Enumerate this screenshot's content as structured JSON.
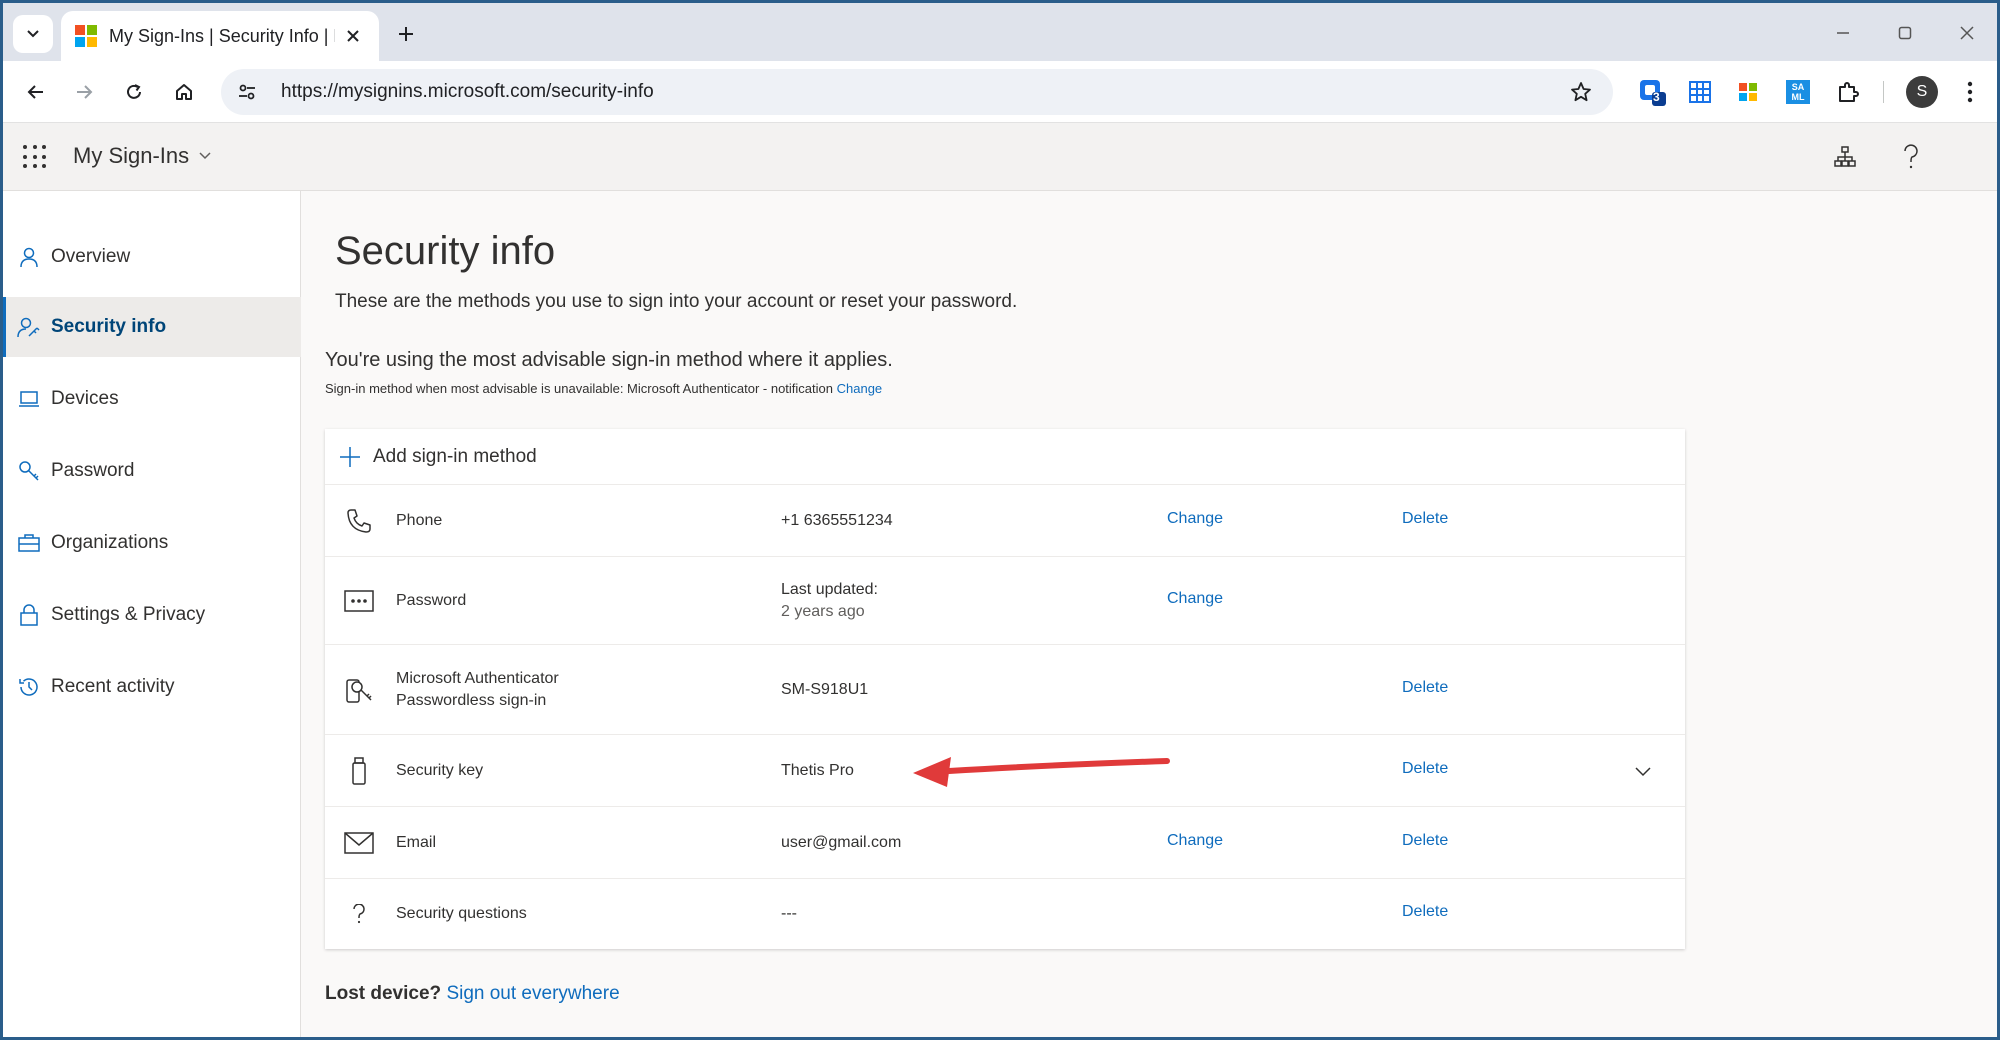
{
  "browser": {
    "tab_title": "My Sign-Ins | Security Info | Mic",
    "url": "https://mysignins.microsoft.com/security-info",
    "ext_badge": "3",
    "ext_saml": "SA ML",
    "profile_initial": "S"
  },
  "app": {
    "name": "My Sign-Ins"
  },
  "sidebar": {
    "items": [
      {
        "label": "Overview",
        "icon": "person-icon"
      },
      {
        "label": "Security info",
        "icon": "person-key-icon",
        "active": true
      },
      {
        "label": "Devices",
        "icon": "laptop-icon"
      },
      {
        "label": "Password",
        "icon": "key-icon"
      },
      {
        "label": "Organizations",
        "icon": "briefcase-icon"
      },
      {
        "label": "Settings & Privacy",
        "icon": "lock-icon"
      },
      {
        "label": "Recent activity",
        "icon": "history-icon"
      }
    ]
  },
  "main": {
    "title": "Security info",
    "subtitle": "These are the methods you use to sign into your account or reset your password.",
    "advisable": "You're using the most advisable sign-in method where it applies.",
    "fallback_text": "Sign-in method when most advisable is unavailable: Microsoft Authenticator - notification",
    "fallback_change": "Change",
    "add_method": "Add sign-in method",
    "methods": [
      {
        "name": "Phone",
        "value": "+1 6365551234",
        "change": "Change",
        "delete": "Delete",
        "icon": "phone-icon"
      },
      {
        "name": "Password",
        "value_line1": "Last updated:",
        "value_line2": "2 years ago",
        "change": "Change",
        "icon": "password-dots-icon"
      },
      {
        "name_line1": "Microsoft Authenticator",
        "name_line2": "Passwordless sign-in",
        "value": "SM-S918U1",
        "delete": "Delete",
        "icon": "authenticator-icon"
      },
      {
        "name": "Security key",
        "value": "Thetis Pro",
        "delete": "Delete",
        "icon": "usb-key-icon"
      },
      {
        "name": "Email",
        "value": "user@gmail.com",
        "change": "Change",
        "delete": "Delete",
        "icon": "mail-icon"
      },
      {
        "name": "Security questions",
        "value": "---",
        "delete": "Delete",
        "icon": "question-icon"
      }
    ],
    "lost_device": "Lost device?",
    "sign_out_everywhere": "Sign out everywhere"
  },
  "colors": {
    "link": "#0f6cbd",
    "annotation_arrow": "#e03a3a",
    "window_border": "#2a5d8a"
  }
}
